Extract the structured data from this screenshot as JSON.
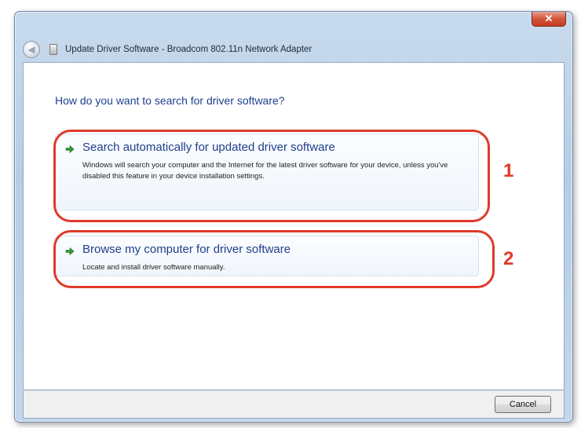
{
  "window": {
    "title": "Update Driver Software - Broadcom 802.11n Network Adapter",
    "close_label": "✕"
  },
  "main": {
    "question": "How do you want to search for driver software?",
    "options": [
      {
        "title": "Search automatically for updated driver software",
        "description": "Windows will search your computer and the Internet for the latest driver software for your device, unless you've disabled this feature in your device installation settings."
      },
      {
        "title": "Browse my computer for driver software",
        "description": "Locate and install driver software manually."
      }
    ]
  },
  "annotations": {
    "labels": [
      "1",
      "2"
    ],
    "color": "#df3a2a"
  },
  "footer": {
    "cancel_label": "Cancel"
  },
  "colors": {
    "link_blue": "#1e3f8a",
    "arrow_green": "#2f9a3a"
  }
}
